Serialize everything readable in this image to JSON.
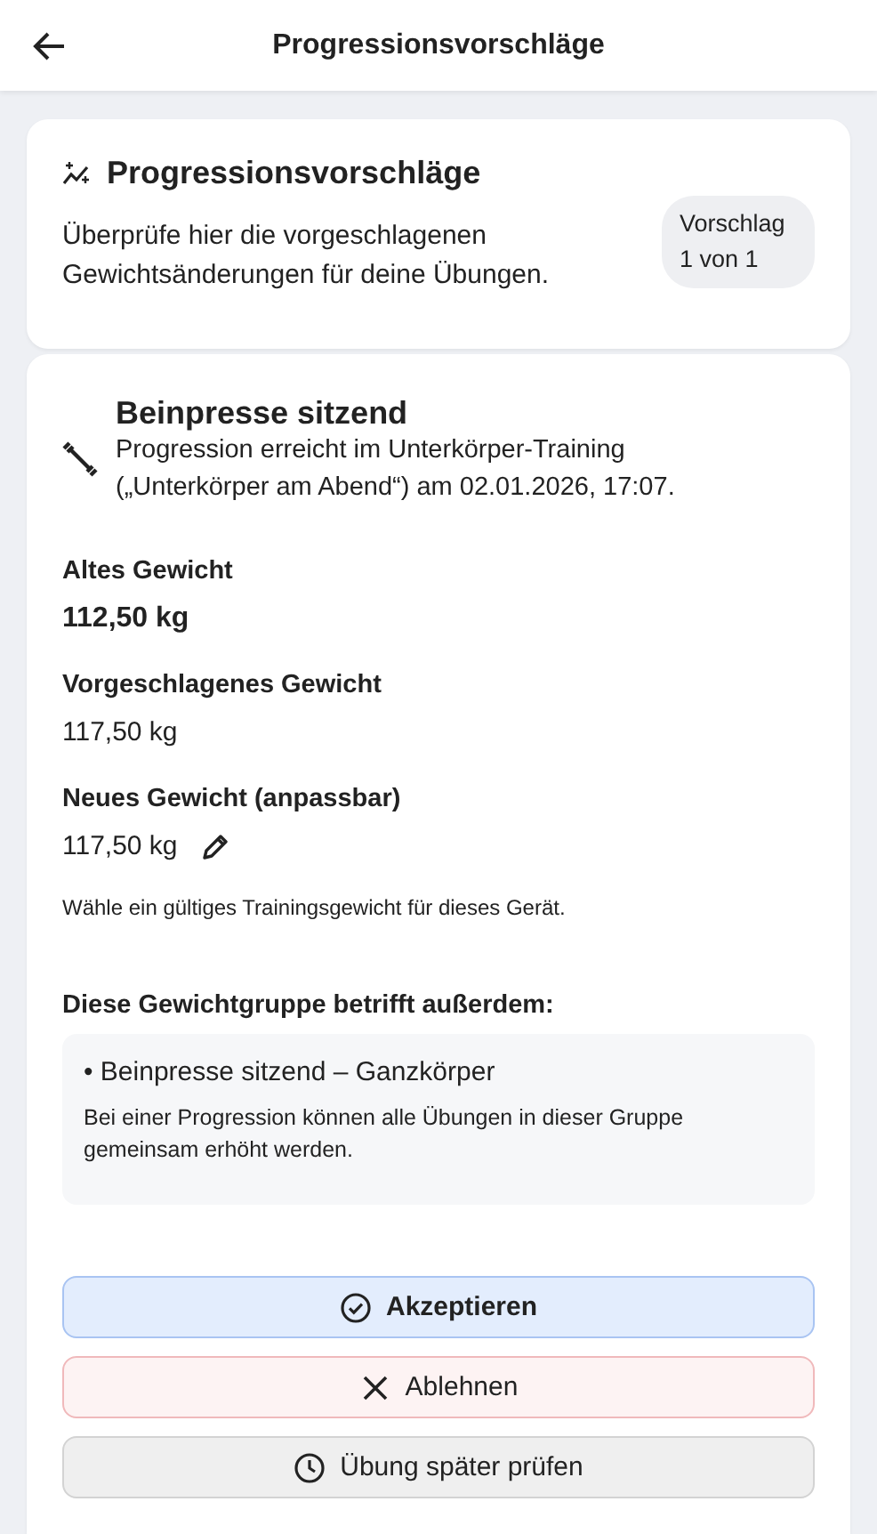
{
  "app_bar": {
    "title": "Progressionsvorschläge"
  },
  "intro": {
    "title": "Progressionsvorschläge",
    "text": "Überprüfe hier die vorgeschlagenen Gewichtsänderungen für deine Übungen.",
    "counter": "Vorschlag 1 von 1"
  },
  "proposal": {
    "exercise": "Beinpresse sitzend",
    "subtitle": "Progression erreicht im Unterkörper-Training („Unterkörper am Abend“) am 02.01.2026, 17:07.",
    "fields": [
      {
        "label": "Altes Gewicht",
        "value": "112,50 kg",
        "kind": "bold"
      },
      {
        "label": "Vorgeschlagenes Gewicht",
        "value": "117,50 kg",
        "kind": "plain"
      },
      {
        "label": "Neues Gewicht (anpassbar)",
        "value": "117,50 kg",
        "kind": "editable"
      }
    ],
    "hint": "Wähle ein gültiges Trainingsgewicht für dieses Gerät.",
    "group_heading": "Diese Gewichtgruppe betrifft außerdem:",
    "group_items": [
      "• Beinpresse sitzend – Ganzkörper"
    ],
    "group_note": "Bei einer Progression können alle Übungen in dieser Gruppe gemeinsam erhöht werden."
  },
  "actions": [
    {
      "label": "Akzeptieren",
      "kind": "accept"
    },
    {
      "label": "Ablehnen",
      "kind": "reject"
    },
    {
      "label": "Übung später prüfen",
      "kind": "later"
    }
  ]
}
